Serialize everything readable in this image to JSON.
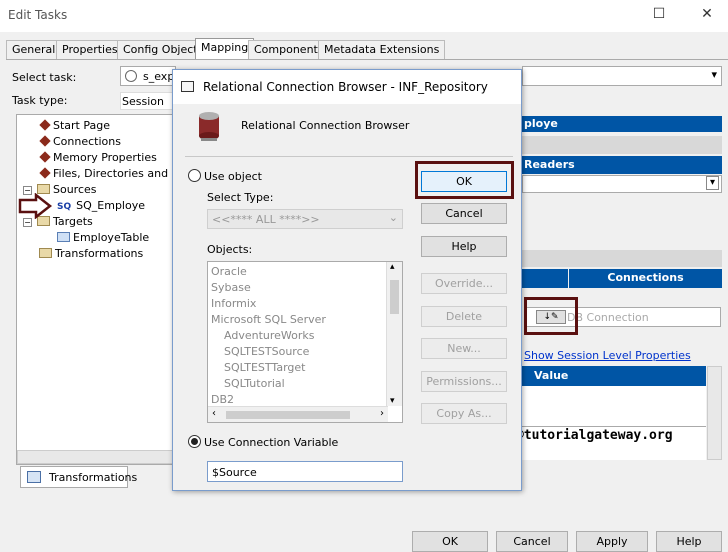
{
  "window": {
    "title": "Edit Tasks",
    "maximize_glyph": "☐",
    "close_glyph": "✕"
  },
  "tabs": [
    {
      "label": "General"
    },
    {
      "label": "Properties"
    },
    {
      "label": "Config Object"
    },
    {
      "label": "Mapping",
      "active": true
    },
    {
      "label": "Components"
    },
    {
      "label": "Metadata Extensions"
    }
  ],
  "form": {
    "select_task_label": "Select task:",
    "select_task_value": "s_exp",
    "task_type_label": "Task type:",
    "task_type_value": "Session"
  },
  "tree": {
    "items": [
      {
        "label": "Start Page"
      },
      {
        "label": "Connections"
      },
      {
        "label": "Memory Properties"
      },
      {
        "label": "Files, Directories and Co"
      },
      {
        "label": "Sources"
      },
      {
        "label": "SQ_Employe",
        "prefix": "SQ"
      },
      {
        "label": "Targets"
      },
      {
        "label": "EmployeTable"
      },
      {
        "label": "Transformations"
      }
    ],
    "expand_glyph": "−",
    "bottom_tab": "Transformations"
  },
  "right_panel": {
    "header_partial": "ploye",
    "readers_label": "Readers",
    "connections_header": "Connections",
    "db_connection_placeholder": "DB Connection",
    "show_session_link": "Show Session Level Properties",
    "value_header": "Value"
  },
  "watermark": "©tutorialgateway.org",
  "dialog": {
    "title": "Relational Connection Browser - INF_Repository",
    "subtitle": "Relational Connection Browser",
    "use_object_label": "Use object",
    "select_type_label": "Select Type:",
    "select_type_value": "<<**** ALL ****>>",
    "objects_label": "Objects:",
    "objects": [
      {
        "label": "Oracle",
        "indent": 0
      },
      {
        "label": "Sybase",
        "indent": 0
      },
      {
        "label": "Informix",
        "indent": 0
      },
      {
        "label": "Microsoft SQL Server",
        "indent": 0
      },
      {
        "label": "AdventureWorks",
        "indent": 1
      },
      {
        "label": "SQLTESTSource",
        "indent": 1
      },
      {
        "label": "SQLTESTTarget",
        "indent": 1
      },
      {
        "label": "SQLTutorial",
        "indent": 1
      },
      {
        "label": "DB2",
        "indent": 0
      }
    ],
    "use_conn_var_label": "Use Connection Variable",
    "conn_var_value": "$Source",
    "buttons": {
      "ok": "OK",
      "cancel": "Cancel",
      "help": "Help",
      "override": "Override...",
      "delete": "Delete",
      "new": "New...",
      "permissions": "Permissions...",
      "copy_as": "Copy As..."
    }
  },
  "footer_buttons": {
    "ok": "OK",
    "cancel": "Cancel",
    "apply": "Apply",
    "help": "Help"
  },
  "colors": {
    "accent_blue": "#0055a5",
    "highlight": "#5a1010"
  }
}
